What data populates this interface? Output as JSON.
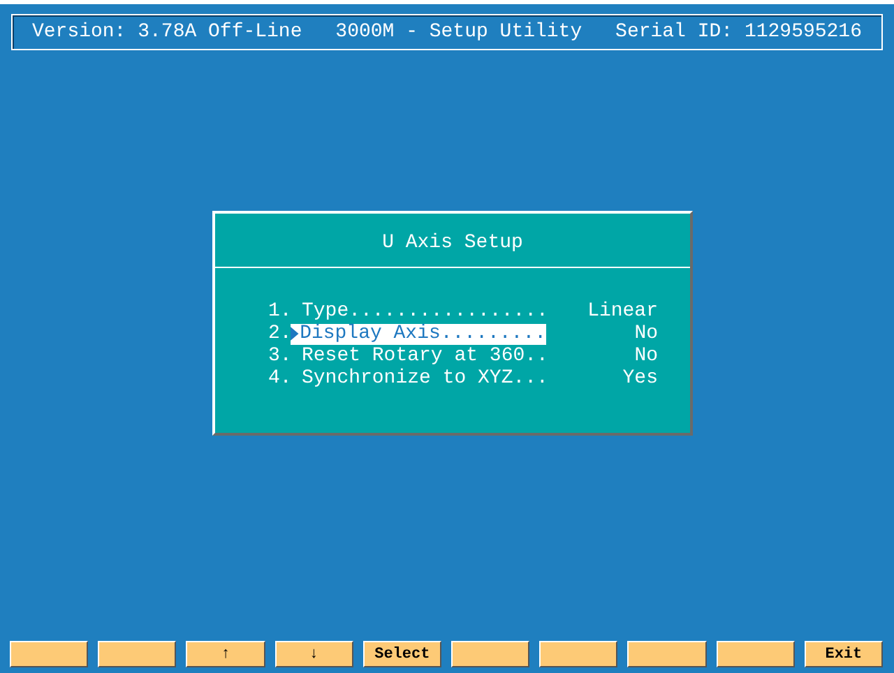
{
  "header": {
    "version": "Version: 3.78A Off-Line",
    "title": "3000M - Setup Utility",
    "serial": "Serial ID: 1129595216"
  },
  "dialog": {
    "title": "U Axis Setup",
    "items": [
      {
        "number": "1.",
        "label": "Type.................",
        "value": "Linear",
        "selected": false
      },
      {
        "number": "2.",
        "label": "Display Axis.........",
        "value": "No",
        "selected": true
      },
      {
        "number": "3.",
        "label": "Reset Rotary at 360..",
        "value": "No",
        "selected": false
      },
      {
        "number": "4.",
        "label": "Synchronize to XYZ...",
        "value": "Yes",
        "selected": false
      }
    ]
  },
  "function_keys": [
    {
      "kind": "blank"
    },
    {
      "kind": "blank"
    },
    {
      "kind": "label",
      "label": "↑"
    },
    {
      "kind": "label",
      "label": "↓"
    },
    {
      "kind": "label",
      "label": "Select"
    },
    {
      "kind": "blank"
    },
    {
      "kind": "blank"
    },
    {
      "kind": "blank"
    },
    {
      "kind": "blank"
    },
    {
      "kind": "label",
      "label": "Exit"
    }
  ]
}
